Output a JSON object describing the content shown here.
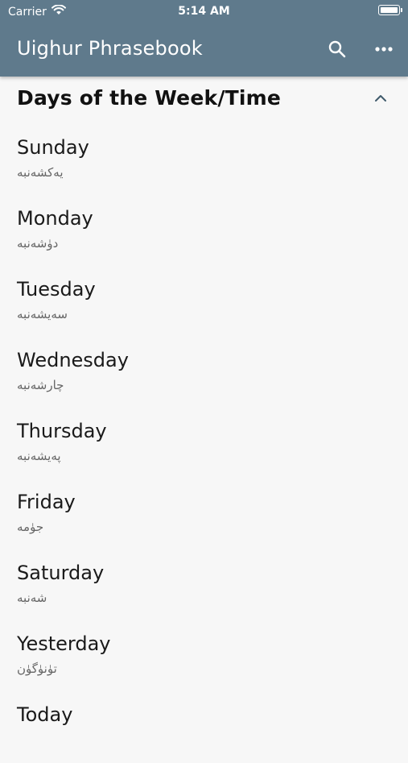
{
  "status": {
    "carrier": "Carrier",
    "time": "5:14 AM"
  },
  "app": {
    "title": "Uighur Phrasebook"
  },
  "icons": {
    "search": "search-icon",
    "more": "more-horizontal-icon",
    "collapse": "chevron-up-icon",
    "wifi": "wifi-icon",
    "battery": "battery-icon"
  },
  "section": {
    "title": "Days of the Week/Time"
  },
  "phrases": [
    {
      "english": "Sunday",
      "uighur": "يەكشەنبە"
    },
    {
      "english": "Monday",
      "uighur": "دۈشەنبە"
    },
    {
      "english": "Tuesday",
      "uighur": "سەيشەنبە"
    },
    {
      "english": "Wednesday",
      "uighur": "چارشەنبە"
    },
    {
      "english": "Thursday",
      "uighur": "پەيشەنبە"
    },
    {
      "english": "Friday",
      "uighur": "جۈمە"
    },
    {
      "english": "Saturday",
      "uighur": "شەنبە"
    },
    {
      "english": "Yesterday",
      "uighur": "تۈنۈگۈن"
    },
    {
      "english": "Today",
      "uighur": ""
    }
  ],
  "colors": {
    "appbar": "#5f7a8c",
    "background": "#f7f7f7",
    "primary_text": "#1a1a1a",
    "secondary_text": "#666666"
  }
}
